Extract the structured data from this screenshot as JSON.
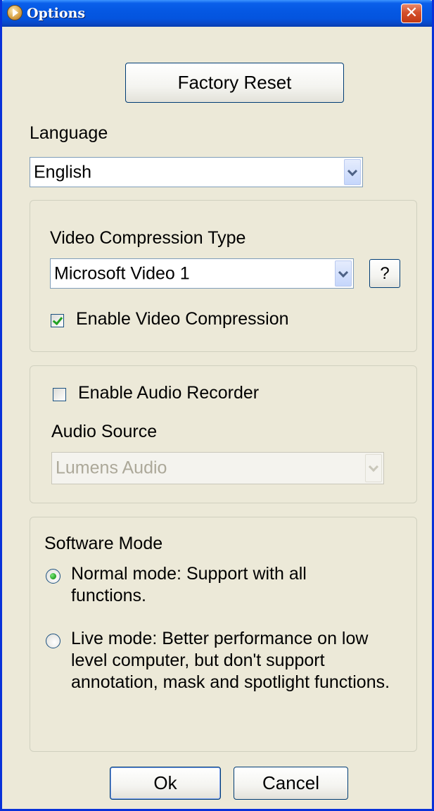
{
  "window": {
    "title": "Options",
    "close_glyph": "✕"
  },
  "factory_reset_label": "Factory Reset",
  "language": {
    "label": "Language",
    "selected": "English"
  },
  "video": {
    "compression_type_label": "Video Compression Type",
    "compression_selected": "Microsoft Video 1",
    "help_label": "?",
    "enable_compression_label": "Enable Video Compression",
    "enable_compression_checked": true
  },
  "audio": {
    "enable_recorder_label": "Enable Audio Recorder",
    "enable_recorder_checked": false,
    "source_label": "Audio Source",
    "source_selected": "Lumens Audio"
  },
  "software_mode": {
    "label": "Software Mode",
    "options": [
      {
        "label": "Normal mode: Support with all functions.",
        "selected": true
      },
      {
        "label": "Live mode: Better performance on low level computer, but don't support annotation, mask and spotlight functions.",
        "selected": false
      }
    ]
  },
  "footer": {
    "ok_label": "Ok",
    "cancel_label": "Cancel"
  },
  "colors": {
    "titlebar": "#0558E3",
    "window_bg": "#ECE9D8",
    "check_green": "#21A121",
    "close_red": "#D4502C"
  }
}
